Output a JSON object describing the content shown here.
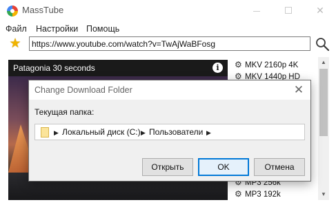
{
  "window": {
    "title": "MassTube"
  },
  "menu": [
    "Файл",
    "Настройки",
    "Помощь"
  ],
  "toolbar": {
    "url": "https://www.youtube.com/watch?v=TwAjWaBFosg"
  },
  "video": {
    "title": "Patagonia 30 seconds"
  },
  "formats": [
    "MKV 2160p 4K",
    "MKV 1440p HD",
    "MP3 256k",
    "MP3 192k"
  ],
  "dialog": {
    "title": "Change Download Folder",
    "current_folder_label": "Текущая папка:",
    "path": [
      "Локальный диск (C:)",
      "Пользователи"
    ],
    "buttons": {
      "open": "Открыть",
      "ok": "OK",
      "cancel": "Отмена"
    }
  },
  "colors": {
    "accent": "#0078d7",
    "star": "#f0b400"
  }
}
